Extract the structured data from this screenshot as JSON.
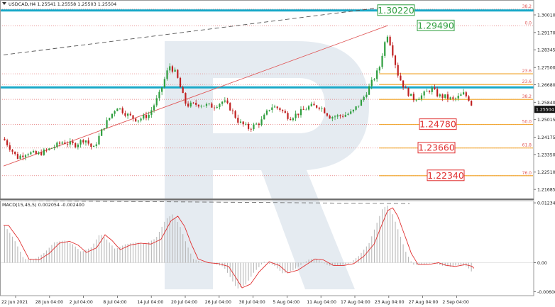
{
  "header": {
    "symbol_line": "USDCAD,H4  1.25541 1.25558 1.25503 1.25504",
    "indicator_line": "MACD(15,45,5) 0.002054 -0.002400"
  },
  "chart_data": [
    {
      "type": "candlestick",
      "title": "USDCAD,H4",
      "ohlc_header": {
        "open": 1.25541,
        "high": 1.25558,
        "low": 1.25503,
        "close": 1.25504
      },
      "ylim": [
        1.2125,
        1.3045
      ],
      "y_ticks": [
        "1.30010",
        "1.29170",
        "1.28345",
        "1.27500",
        "1.26680",
        "1.25840",
        "1.25015",
        "1.24175",
        "1.23350",
        "1.22510",
        "1.21685"
      ],
      "y_tick_values": [
        1.3001,
        1.2917,
        1.28345,
        1.275,
        1.2668,
        1.2584,
        1.25015,
        1.24175,
        1.2335,
        1.2251,
        1.21685
      ],
      "current_price": "1.25504",
      "x_labels": [
        "22 Jun 2021",
        "28 Jun 04:00",
        "2 Jul 04:00",
        "8 Jul 04:00",
        "14 Jul 04:00",
        "20 Jul 04:00",
        "26 Jul 04:00",
        "30 Jul 04:00",
        "5 Aug 04:00",
        "11 Aug 04:00",
        "17 Aug 04:00",
        "23 Aug 04:00",
        "27 Aug 04:00",
        "2 Sep 04:00"
      ],
      "close_path": [
        {
          "x": 0,
          "y": 1.241
        },
        {
          "x": 8,
          "y": 1.232
        },
        {
          "x": 14,
          "y": 1.2345
        },
        {
          "x": 20,
          "y": 1.2335
        },
        {
          "x": 27,
          "y": 1.236
        },
        {
          "x": 35,
          "y": 1.2395
        },
        {
          "x": 42,
          "y": 1.238
        },
        {
          "x": 48,
          "y": 1.241
        },
        {
          "x": 53,
          "y": 1.236
        },
        {
          "x": 59,
          "y": 1.2465
        },
        {
          "x": 67,
          "y": 1.2565
        },
        {
          "x": 73,
          "y": 1.2525
        },
        {
          "x": 79,
          "y": 1.25
        },
        {
          "x": 86,
          "y": 1.2525
        },
        {
          "x": 92,
          "y": 1.262
        },
        {
          "x": 98,
          "y": 1.276
        },
        {
          "x": 102,
          "y": 1.272
        },
        {
          "x": 105,
          "y": 1.264
        },
        {
          "x": 108,
          "y": 1.257
        },
        {
          "x": 115,
          "y": 1.2575
        },
        {
          "x": 124,
          "y": 1.2565
        },
        {
          "x": 130,
          "y": 1.259
        },
        {
          "x": 134,
          "y": 1.2555
        },
        {
          "x": 139,
          "y": 1.249
        },
        {
          "x": 145,
          "y": 1.246
        },
        {
          "x": 152,
          "y": 1.249
        },
        {
          "x": 158,
          "y": 1.2565
        },
        {
          "x": 163,
          "y": 1.2555
        },
        {
          "x": 169,
          "y": 1.251
        },
        {
          "x": 175,
          "y": 1.2535
        },
        {
          "x": 181,
          "y": 1.2565
        },
        {
          "x": 187,
          "y": 1.2565
        },
        {
          "x": 193,
          "y": 1.2515
        },
        {
          "x": 200,
          "y": 1.252
        },
        {
          "x": 206,
          "y": 1.2535
        },
        {
          "x": 212,
          "y": 1.2595
        },
        {
          "x": 217,
          "y": 1.267
        },
        {
          "x": 222,
          "y": 1.2745
        },
        {
          "x": 225,
          "y": 1.286
        },
        {
          "x": 227,
          "y": 1.291
        },
        {
          "x": 230,
          "y": 1.282
        },
        {
          "x": 233,
          "y": 1.272
        },
        {
          "x": 237,
          "y": 1.265
        },
        {
          "x": 242,
          "y": 1.26
        },
        {
          "x": 247,
          "y": 1.2615
        },
        {
          "x": 253,
          "y": 1.265
        },
        {
          "x": 257,
          "y": 1.2615
        },
        {
          "x": 261,
          "y": 1.261
        },
        {
          "x": 266,
          "y": 1.2595
        },
        {
          "x": 272,
          "y": 1.2625
        },
        {
          "x": 275,
          "y": 1.26
        },
        {
          "x": 278,
          "y": 1.25504
        }
      ],
      "lines": [
        {
          "label": "1.30220",
          "price": 1.3022,
          "style": "resistance",
          "color": "#19a9c8"
        },
        {
          "label": "1.26680",
          "price": 1.2655,
          "style": "resistance",
          "color": "#19a9c8"
        },
        {
          "label": "upper channel",
          "style": "dashed-trendline",
          "color": "#555555",
          "from": {
            "x": 0,
            "y": 1.281
          },
          "to": {
            "x": 222,
            "y": 1.3035
          }
        },
        {
          "label": "support trendline",
          "style": "trendline",
          "color": "#e05858",
          "from": {
            "x": 0,
            "y": 1.228
          },
          "to": {
            "x": 227,
            "y": 1.295
          }
        }
      ],
      "fibonacci_levels": [
        {
          "label": "38.2",
          "price": 1.3028
        },
        {
          "label": "0.0",
          "price": 1.2949
        },
        {
          "label": "23.6",
          "price": 1.272
        },
        {
          "label": "23.6",
          "price": 1.2669
        },
        {
          "label": "38.2",
          "price": 1.2598
        },
        {
          "label": "50.0",
          "price": 1.2478
        },
        {
          "label": "61.8",
          "price": 1.2366
        },
        {
          "label": "76.0",
          "price": 1.2234
        }
      ],
      "annotations": [
        {
          "text": "1.30220",
          "price": 1.3022,
          "color": "#2e9e3e"
        },
        {
          "text": "1.29490",
          "price": 1.2949,
          "color": "#2e9e3e"
        },
        {
          "text": "1.24780",
          "price": 1.2478,
          "color": "#e03030"
        },
        {
          "text": "1.23660",
          "price": 1.2366,
          "color": "#e03030"
        },
        {
          "text": "1.22340",
          "price": 1.2234,
          "color": "#e03030"
        }
      ],
      "colors": {
        "up": "#2e9e3e",
        "down": "#c02020",
        "resistance": "#19a9c8",
        "fib_red": "#e05858",
        "fib_orange": "#f0a020"
      }
    },
    {
      "type": "histogram",
      "title": "MACD(15,45,5)",
      "values_header": [
        0.002054,
        -0.0024
      ],
      "y_ticks": [
        "0.012347",
        "0.00",
        "-0.006002"
      ],
      "y_tick_values": [
        0.012347,
        0.0,
        -0.006002
      ],
      "ylim": [
        -0.0068,
        0.0128
      ],
      "histogram": [
        {
          "x": 0,
          "y": 0.008
        },
        {
          "x": 6,
          "y": 0.005
        },
        {
          "x": 12,
          "y": 0.0008
        },
        {
          "x": 18,
          "y": 0.0006
        },
        {
          "x": 24,
          "y": 0.002
        },
        {
          "x": 30,
          "y": 0.0042
        },
        {
          "x": 36,
          "y": 0.0046
        },
        {
          "x": 41,
          "y": 0.0038
        },
        {
          "x": 46,
          "y": 0.0022
        },
        {
          "x": 52,
          "y": 0.0032
        },
        {
          "x": 57,
          "y": 0.006
        },
        {
          "x": 61,
          "y": 0.0048
        },
        {
          "x": 66,
          "y": 0.0028
        },
        {
          "x": 72,
          "y": 0.0038
        },
        {
          "x": 78,
          "y": 0.0042
        },
        {
          "x": 84,
          "y": 0.004
        },
        {
          "x": 90,
          "y": 0.005
        },
        {
          "x": 96,
          "y": 0.009
        },
        {
          "x": 100,
          "y": 0.01
        },
        {
          "x": 104,
          "y": 0.0078
        },
        {
          "x": 108,
          "y": 0.004
        },
        {
          "x": 112,
          "y": 0.0008
        },
        {
          "x": 118,
          "y": 0.0
        },
        {
          "x": 124,
          "y": -0.0002
        },
        {
          "x": 130,
          "y": -0.0008
        },
        {
          "x": 134,
          "y": -0.003
        },
        {
          "x": 138,
          "y": -0.0054
        },
        {
          "x": 143,
          "y": -0.0046
        },
        {
          "x": 148,
          "y": -0.002
        },
        {
          "x": 154,
          "y": 0.0002
        },
        {
          "x": 160,
          "y": -0.0006
        },
        {
          "x": 165,
          "y": -0.0022
        },
        {
          "x": 171,
          "y": -0.0016
        },
        {
          "x": 176,
          "y": -0.0004
        },
        {
          "x": 181,
          "y": 0.0008
        },
        {
          "x": 186,
          "y": 0.0006
        },
        {
          "x": 192,
          "y": -0.0006
        },
        {
          "x": 198,
          "y": -0.0006
        },
        {
          "x": 204,
          "y": -0.0002
        },
        {
          "x": 210,
          "y": 0.0014
        },
        {
          "x": 216,
          "y": 0.004
        },
        {
          "x": 221,
          "y": 0.0085
        },
        {
          "x": 224,
          "y": 0.0112
        },
        {
          "x": 227,
          "y": 0.0118
        },
        {
          "x": 230,
          "y": 0.01
        },
        {
          "x": 234,
          "y": 0.006
        },
        {
          "x": 238,
          "y": 0.002
        },
        {
          "x": 242,
          "y": -0.0004
        },
        {
          "x": 248,
          "y": -0.0004
        },
        {
          "x": 254,
          "y": 0.0
        },
        {
          "x": 259,
          "y": -0.0006
        },
        {
          "x": 264,
          "y": -0.0008
        },
        {
          "x": 270,
          "y": -0.0004
        },
        {
          "x": 274,
          "y": -0.0008
        },
        {
          "x": 278,
          "y": -0.0024
        }
      ],
      "signal_color": "#e03030",
      "histogram_color": "#b8b8b8"
    }
  ],
  "timeframe_menu_icon": "triangle-down-icon"
}
